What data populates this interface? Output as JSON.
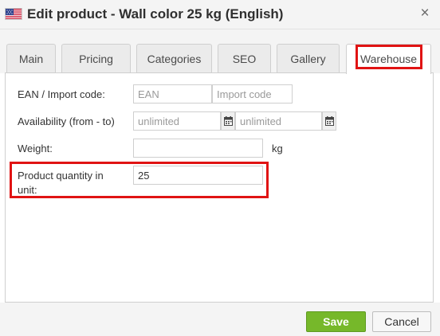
{
  "dialog": {
    "title": "Edit product - Wall color 25 kg (English)",
    "flag_icon": "us-flag-icon",
    "close_icon": "close-icon",
    "close_glyph": "×"
  },
  "tabs": [
    {
      "label": "Main",
      "active": false
    },
    {
      "label": "Pricing",
      "active": false
    },
    {
      "label": "Categories",
      "active": false
    },
    {
      "label": "SEO",
      "active": false
    },
    {
      "label": "Gallery",
      "active": false
    },
    {
      "label": "Warehouse",
      "active": true
    }
  ],
  "form": {
    "ean_row": {
      "label": "EAN / Import code:",
      "ean_placeholder": "EAN",
      "ean_value": "",
      "import_placeholder": "Import code",
      "import_value": ""
    },
    "availability_row": {
      "label": "Availability (from - to)",
      "from_placeholder": "unlimited",
      "from_value": "",
      "to_placeholder": "unlimited",
      "to_value": "",
      "calendar_icon": "calendar-icon"
    },
    "weight_row": {
      "label": "Weight:",
      "value": "",
      "unit": "kg"
    },
    "quantity_row": {
      "label_line1": "Product quantity in",
      "label_line2": "unit:",
      "value": "25"
    }
  },
  "footer": {
    "save_label": "Save",
    "cancel_label": "Cancel"
  },
  "colors": {
    "highlight": "#e01313",
    "save_button": "#76b82a",
    "header_bg": "#f4f4f4"
  }
}
